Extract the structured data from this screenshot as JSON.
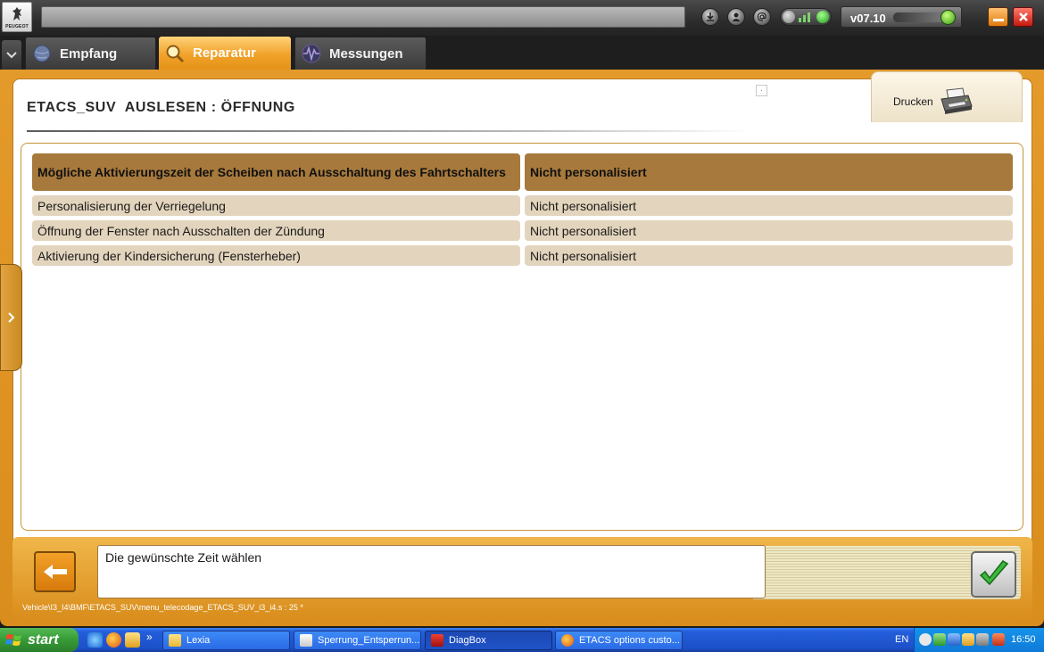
{
  "app": {
    "logo_text": "PEUGEOT",
    "version": "v07.10"
  },
  "tabs": [
    {
      "label": "Empfang",
      "icon": "globe-icon"
    },
    {
      "label": "Reparatur",
      "icon": "magnifier-icon"
    },
    {
      "label": "Messungen",
      "icon": "waveform-icon"
    }
  ],
  "page": {
    "title": "ETACS_SUV  AUSLESEN : ÖFFNUNG",
    "print_label": "Drucken"
  },
  "table": {
    "header": [
      "Mögliche Aktivierungszeit der Scheiben nach Ausschaltung des Fahrtschalters",
      "Nicht personalisiert"
    ],
    "rows": [
      [
        "Personalisierung der Verriegelung",
        "Nicht personalisiert"
      ],
      [
        "Öffnung der Fenster nach Ausschalten der Zündung",
        "Nicht personalisiert"
      ],
      [
        "Aktivierung der Kindersicherung (Fensterheber)",
        "Nicht personalisiert"
      ]
    ]
  },
  "bottom": {
    "message": "Die gewünschte Zeit wählen",
    "path": "Vehicle\\I3_I4\\BMF\\ETACS_SUV\\menu_telecodage_ETACS_SUV_i3_i4.s : 25 *"
  },
  "taskbar": {
    "start_label": "start",
    "quick_overflow": "»",
    "windows": [
      {
        "label": "Lexia",
        "icon": "folder-icon",
        "active": false
      },
      {
        "label": "Sperrung_Entsperrun...",
        "icon": "document-icon",
        "active": false
      },
      {
        "label": "DiagBox",
        "icon": "diagbox-icon",
        "active": true
      },
      {
        "label": "ETACS options custo...",
        "icon": "firefox-icon",
        "active": false
      }
    ],
    "language": "EN",
    "clock": "16:50"
  },
  "colors": {
    "accent_orange": "#E49A2A",
    "table_header": "#A7793C",
    "table_row": "#E3D5BD",
    "taskbar_blue": "#245EDB",
    "start_green": "#369A36"
  }
}
